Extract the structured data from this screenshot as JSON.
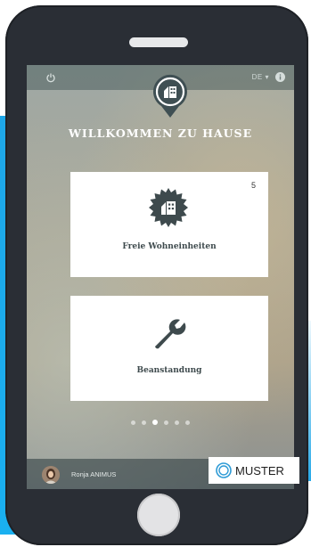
{
  "header": {
    "language": "DE",
    "language_separator": "▾"
  },
  "screen": {
    "title": "WILLKOMMEN ZU HAUSE"
  },
  "cards": [
    {
      "label": "Freie Wohneinheiten",
      "count": "5",
      "icon": "house-badge-icon"
    },
    {
      "label": "Beanstandung",
      "icon": "wrench-icon"
    }
  ],
  "carousel": {
    "total": 6,
    "active_index": 2
  },
  "footer": {
    "user_name": "Ronja ANIMUS",
    "brand_label": "MUSTER"
  },
  "colors": {
    "accent": "#2e9bd6",
    "phone_body": "#2a2e35",
    "stripe": "#1ea7e8",
    "card_icon": "#3e4a4d"
  }
}
